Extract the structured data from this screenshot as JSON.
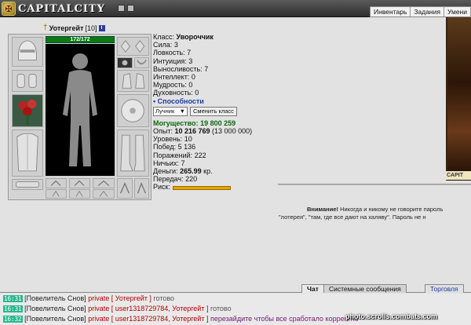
{
  "logo": {
    "text": "CAPITALCITY"
  },
  "topnav": [
    "Инвентарь",
    "Задания",
    "Умени"
  ],
  "character": {
    "name": "Уотергейт",
    "level": "[10]",
    "hp": "172/172"
  },
  "stats": {
    "class_label": "Класс:",
    "class_value": "Увороччик",
    "rows": [
      {
        "label": "Сила:",
        "value": "3"
      },
      {
        "label": "Ловкость:",
        "value": "7"
      },
      {
        "label": "Интуиция:",
        "value": "3"
      },
      {
        "label": "Выносливость:",
        "value": "7"
      },
      {
        "label": "Интеллект:",
        "value": "0"
      },
      {
        "label": "Мудрость:",
        "value": "0"
      },
      {
        "label": "Духовность:",
        "value": "0"
      }
    ],
    "abilities": "• Способности",
    "class_select": "Лучник",
    "change_class_button": "Сменить класс",
    "power_label": "Могущество:",
    "power_value": "19 800 259",
    "exp_label": "Опыт:",
    "exp_value": "10 216 769",
    "exp_next": "(13 000 000)",
    "level_label": "Уровень:",
    "level_value": "10",
    "wins_label": "Побед:",
    "wins_value": "5 136",
    "losses_label": "Поражений:",
    "losses_value": "222",
    "draws_label": "Ничьих:",
    "draws_value": "7",
    "money_label": "Деньги:",
    "money_value": "265.99",
    "money_unit": "кр.",
    "transfer_label": "Передач:",
    "transfer_value": "220",
    "risk_label": "Риск:"
  },
  "side": {
    "label": "CAPIT"
  },
  "warning": {
    "title": "Внимание!",
    "line1": "Никогда и никому не говорите пароль",
    "line2": "\"лотерея\", \"там, где все дают на халяву\". Пароль не н"
  },
  "chat_tabs": {
    "chat": "Чат",
    "system": "Системные сообщения",
    "trade": "Торговля"
  },
  "chat": [
    {
      "time": "16:31",
      "who": "[Повелитель Снов]",
      "priv": "private [ Уотергейт ]",
      "text": "готово"
    },
    {
      "time": "16:31",
      "who": "[Повелитель Снов]",
      "priv": "private [ user1318729784, Уотергейт ]",
      "text": "готово"
    },
    {
      "time": "16:32",
      "who": "[Повелитель Снов]",
      "priv": "private [ user1318729784, Уотергейт ]",
      "text": "перезайдите чтобы все сработало корректно"
    }
  ],
  "watermark": "photo.scrolls.combats.com",
  "colors": {
    "hp": "#0d7a0d",
    "private": "#b00000",
    "time_badge": "#2ab890",
    "accent_blue": "#1a3fa0"
  }
}
